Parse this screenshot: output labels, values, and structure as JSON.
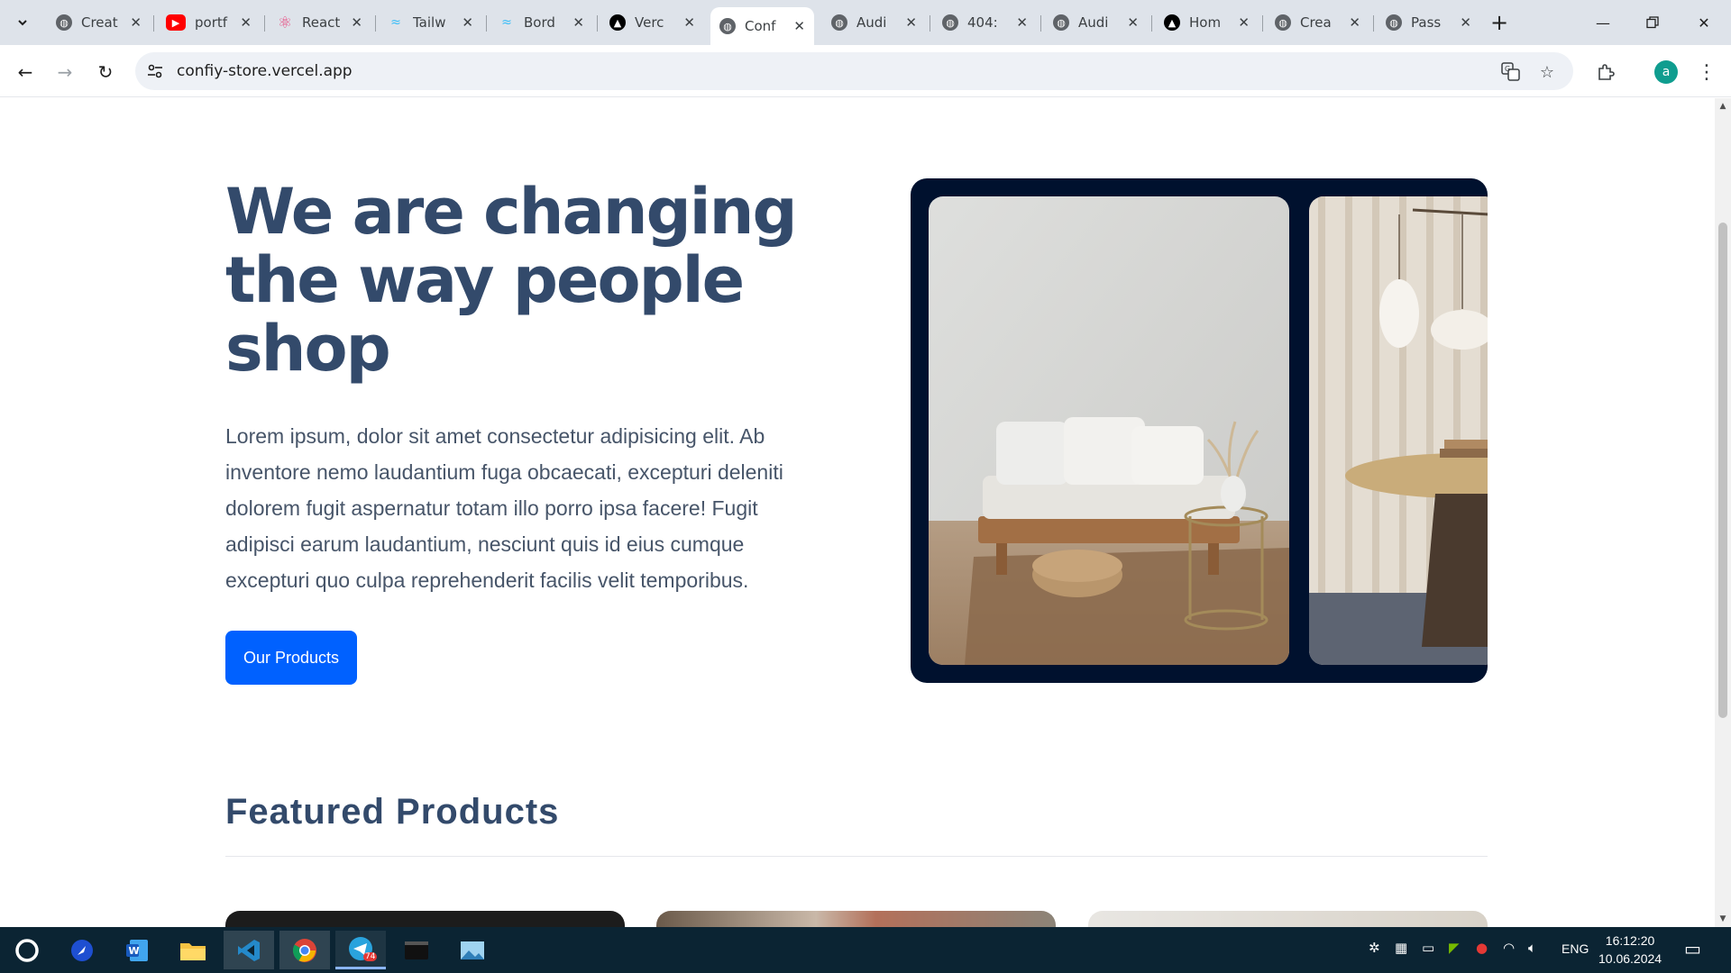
{
  "browser": {
    "tabs": [
      {
        "label": "Creat",
        "favicon": "globe-icon"
      },
      {
        "label": "portf",
        "favicon": "youtube-icon"
      },
      {
        "label": "React",
        "favicon": "react-icon"
      },
      {
        "label": "Tailw",
        "favicon": "tailwind-icon"
      },
      {
        "label": "Bord",
        "favicon": "tailwind-icon"
      },
      {
        "label": "Verc",
        "favicon": "vercel-icon"
      },
      {
        "label": "Conf",
        "favicon": "globe-icon",
        "active": true
      },
      {
        "label": "Audi",
        "favicon": "globe-icon"
      },
      {
        "label": "404:",
        "favicon": "globe-icon"
      },
      {
        "label": "Audi",
        "favicon": "globe-icon"
      },
      {
        "label": "Hom",
        "favicon": "vercel-icon"
      },
      {
        "label": "Crea",
        "favicon": "globe-icon"
      },
      {
        "label": "Pass",
        "favicon": "globe-icon"
      }
    ],
    "url": "confiy-store.vercel.app",
    "profile_initial": "a"
  },
  "page": {
    "hero_title": "We are changing the way people shop",
    "hero_text": "Lorem ipsum, dolor sit amet consectetur adipisicing elit. Ab inventore nemo laudantium fuga obcaecati, excepturi deleniti dolorem fugit aspernatur totam illo porro ipsa facere! Fugit adipisci earum laudantium, nesciunt quis id eius cumque excepturi quo culpa reprehenderit facilis velit temporibus.",
    "cta_label": "Our Products",
    "featured_title": "Featured Products"
  },
  "taskbar": {
    "language": "ENG",
    "time": "16:12:20",
    "date": "10.06.2024",
    "telegram_badge": "74"
  },
  "colors": {
    "heading": "#334a6b",
    "accent": "#0061ff",
    "carousel_bg": "#00112e"
  }
}
